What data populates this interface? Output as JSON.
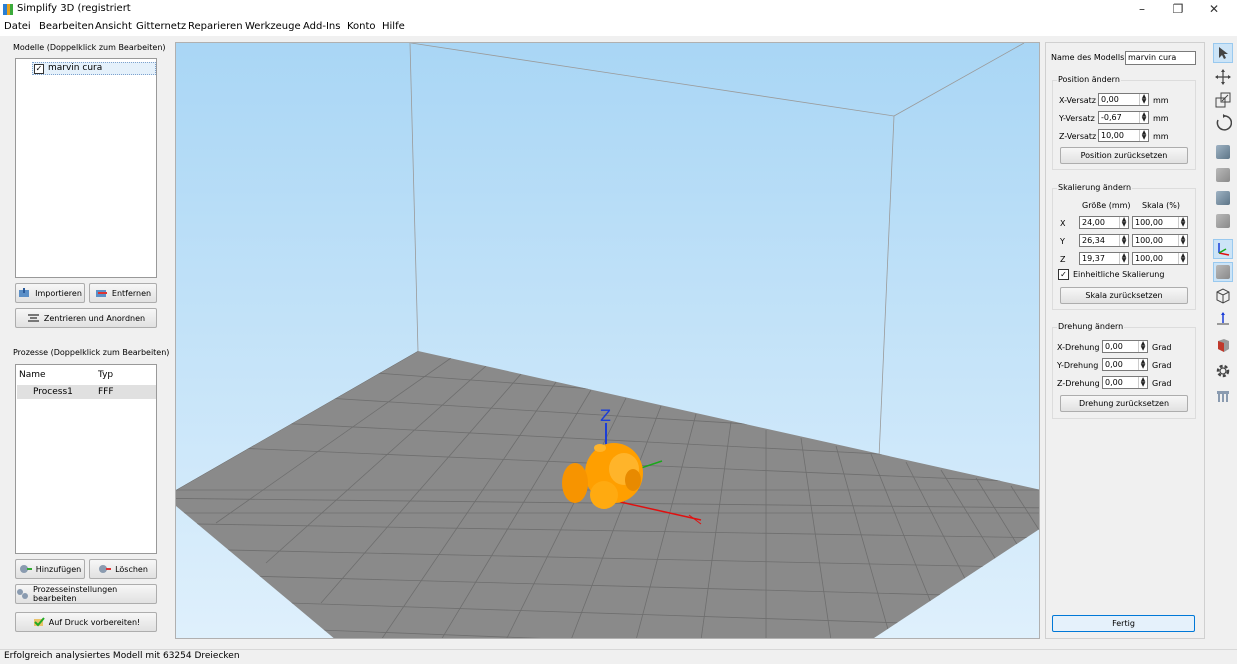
{
  "window": {
    "title": "Simplify 3D (registriert",
    "min_icon": "minimize-icon",
    "max_icon": "maximize-icon",
    "close_icon": "close-icon"
  },
  "menu": [
    "Datei",
    "Bearbeiten",
    "Ansicht",
    "Gitternetz",
    "Reparieren",
    "Werkzeuge",
    "Add-Ins",
    "Konto",
    "Hilfe"
  ],
  "models": {
    "header": "Modelle (Doppelklick zum Bearbeiten)",
    "items": [
      {
        "label": "marvin cura",
        "checked": true
      }
    ],
    "import_label": "Importieren",
    "remove_label": "Entfernen",
    "center_label": "Zentrieren und Anordnen"
  },
  "processes": {
    "header": "Prozesse (Doppelklick zum Bearbeiten)",
    "col_name": "Name",
    "col_type": "Typ",
    "rows": [
      {
        "name": "Process1",
        "type": "FFF"
      }
    ],
    "add_label": "Hinzufügen",
    "delete_label": "Löschen",
    "edit_label": "Prozesseinstellungen bearbeiten",
    "prepare_label": "Auf Druck vorbereiten!"
  },
  "viewport": {
    "axis_label": "Z",
    "model_color": "#ffa500",
    "bg_top": "#a9d6f5",
    "bg_bottom": "#d9eefc",
    "bed_color": "#8a8a8a"
  },
  "properties": {
    "name_label": "Name des Modells:",
    "name_value": "marvin cura",
    "position": {
      "title": "Position ändern",
      "x_label": "X-Versatz",
      "x_value": "0,00",
      "y_label": "Y-Versatz",
      "y_value": "-0,67",
      "z_label": "Z-Versatz",
      "z_value": "10,00",
      "unit": "mm",
      "reset_label": "Position zurücksetzen"
    },
    "scale": {
      "title": "Skalierung ändern",
      "col_size": "Größe (mm)",
      "col_scale": "Skala (%)",
      "rows": [
        {
          "axis": "X",
          "size": "24,00",
          "scale": "100,00"
        },
        {
          "axis": "Y",
          "size": "26,34",
          "scale": "100,00"
        },
        {
          "axis": "Z",
          "size": "19,37",
          "scale": "100,00"
        }
      ],
      "uniform_label": "Einheitliche Skalierung",
      "uniform_checked": true,
      "reset_label": "Skala zurücksetzen"
    },
    "rotation": {
      "title": "Drehung ändern",
      "x_label": "X-Drehung",
      "x_value": "0,00",
      "y_label": "Y-Drehung",
      "y_value": "0,00",
      "z_label": "Z-Drehung",
      "z_value": "0,00",
      "unit": "Grad",
      "reset_label": "Drehung zurücksetzen"
    },
    "done_label": "Fertig"
  },
  "toolbar": [
    "select-icon",
    "move-icon",
    "scale-icon",
    "rotate-icon",
    "view-front-icon",
    "view-back-icon",
    "view-left-icon",
    "view-right-icon",
    "axes-icon",
    "solid-view-icon",
    "wireframe-icon",
    "cross-section-icon",
    "model-settings-icon",
    "gear-icon",
    "supports-icon"
  ],
  "status": {
    "text": "Erfolgreich analysiertes Modell mit 63254 Dreiecken"
  }
}
